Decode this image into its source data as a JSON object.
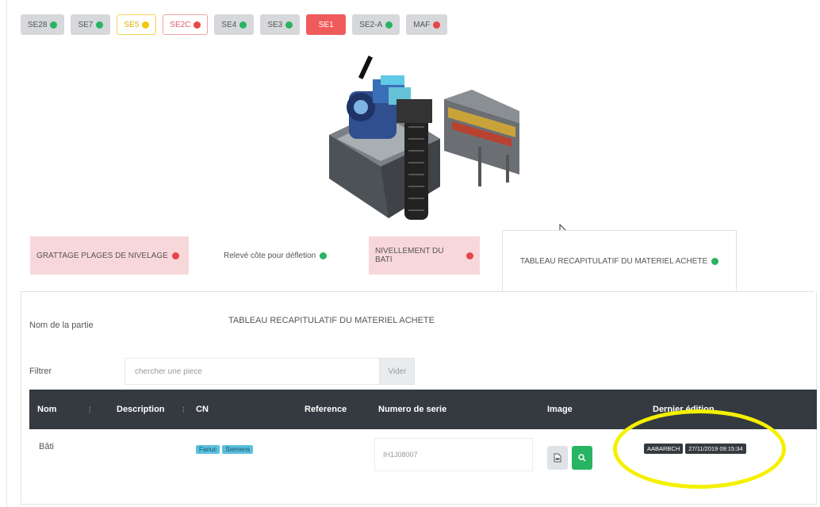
{
  "stations": [
    {
      "label": "SE28",
      "status": "green",
      "style": "gray"
    },
    {
      "label": "SE7",
      "status": "green",
      "style": "gray"
    },
    {
      "label": "SE5",
      "status": "yellow",
      "style": "warn"
    },
    {
      "label": "SE2C",
      "status": "red",
      "style": "danger-o"
    },
    {
      "label": "SE4",
      "status": "green",
      "style": "gray"
    },
    {
      "label": "SE3",
      "status": "green",
      "style": "gray"
    },
    {
      "label": "SE1",
      "status": "",
      "style": "active"
    },
    {
      "label": "SE2-A",
      "status": "green",
      "style": "gray"
    },
    {
      "label": "MAF",
      "status": "red",
      "style": "gray"
    }
  ],
  "part_tabs": [
    {
      "label": "GRATTAGE PLAGES DE NIVELAGE",
      "status": "red"
    },
    {
      "label": "Relevé côte pour défletion",
      "status": "green"
    },
    {
      "label": "NIVELLEMENT DU BATI",
      "status": "red"
    },
    {
      "label": "TABLEAU RECAPITULATIF DU MATERIEL ACHETE",
      "status": "green"
    }
  ],
  "panel": {
    "part_name_label": "Nom de la partie",
    "part_name_value": "TABLEAU RECAPITULATIF DU MATERIEL ACHETE",
    "filter_label": "Filtrer",
    "filter_placeholder": "chercher une piece",
    "clear_button": "Vider"
  },
  "table": {
    "headers": [
      "Nom",
      "Description",
      "CN",
      "Reference",
      "Numero de serie",
      "Image",
      "Dernier édition"
    ],
    "rows": [
      {
        "nom": "Bâti",
        "description": "",
        "cn_badges": [
          "Fanuc",
          "Siemens"
        ],
        "reference": "",
        "serial": "IH1J08007",
        "editor": "AABARBCH",
        "edited_at": "27/11/2019 09:15:34"
      }
    ]
  },
  "icons": [
    "file-icon",
    "search-icon",
    "mouse-pointer-icon",
    "machine-image"
  ],
  "colors": {
    "green": "#28b463",
    "red": "#e64646",
    "yellow": "#f2c70c",
    "active_station": "#ef5b5b",
    "table_header": "#343a40",
    "highlight": "#f5f000"
  }
}
